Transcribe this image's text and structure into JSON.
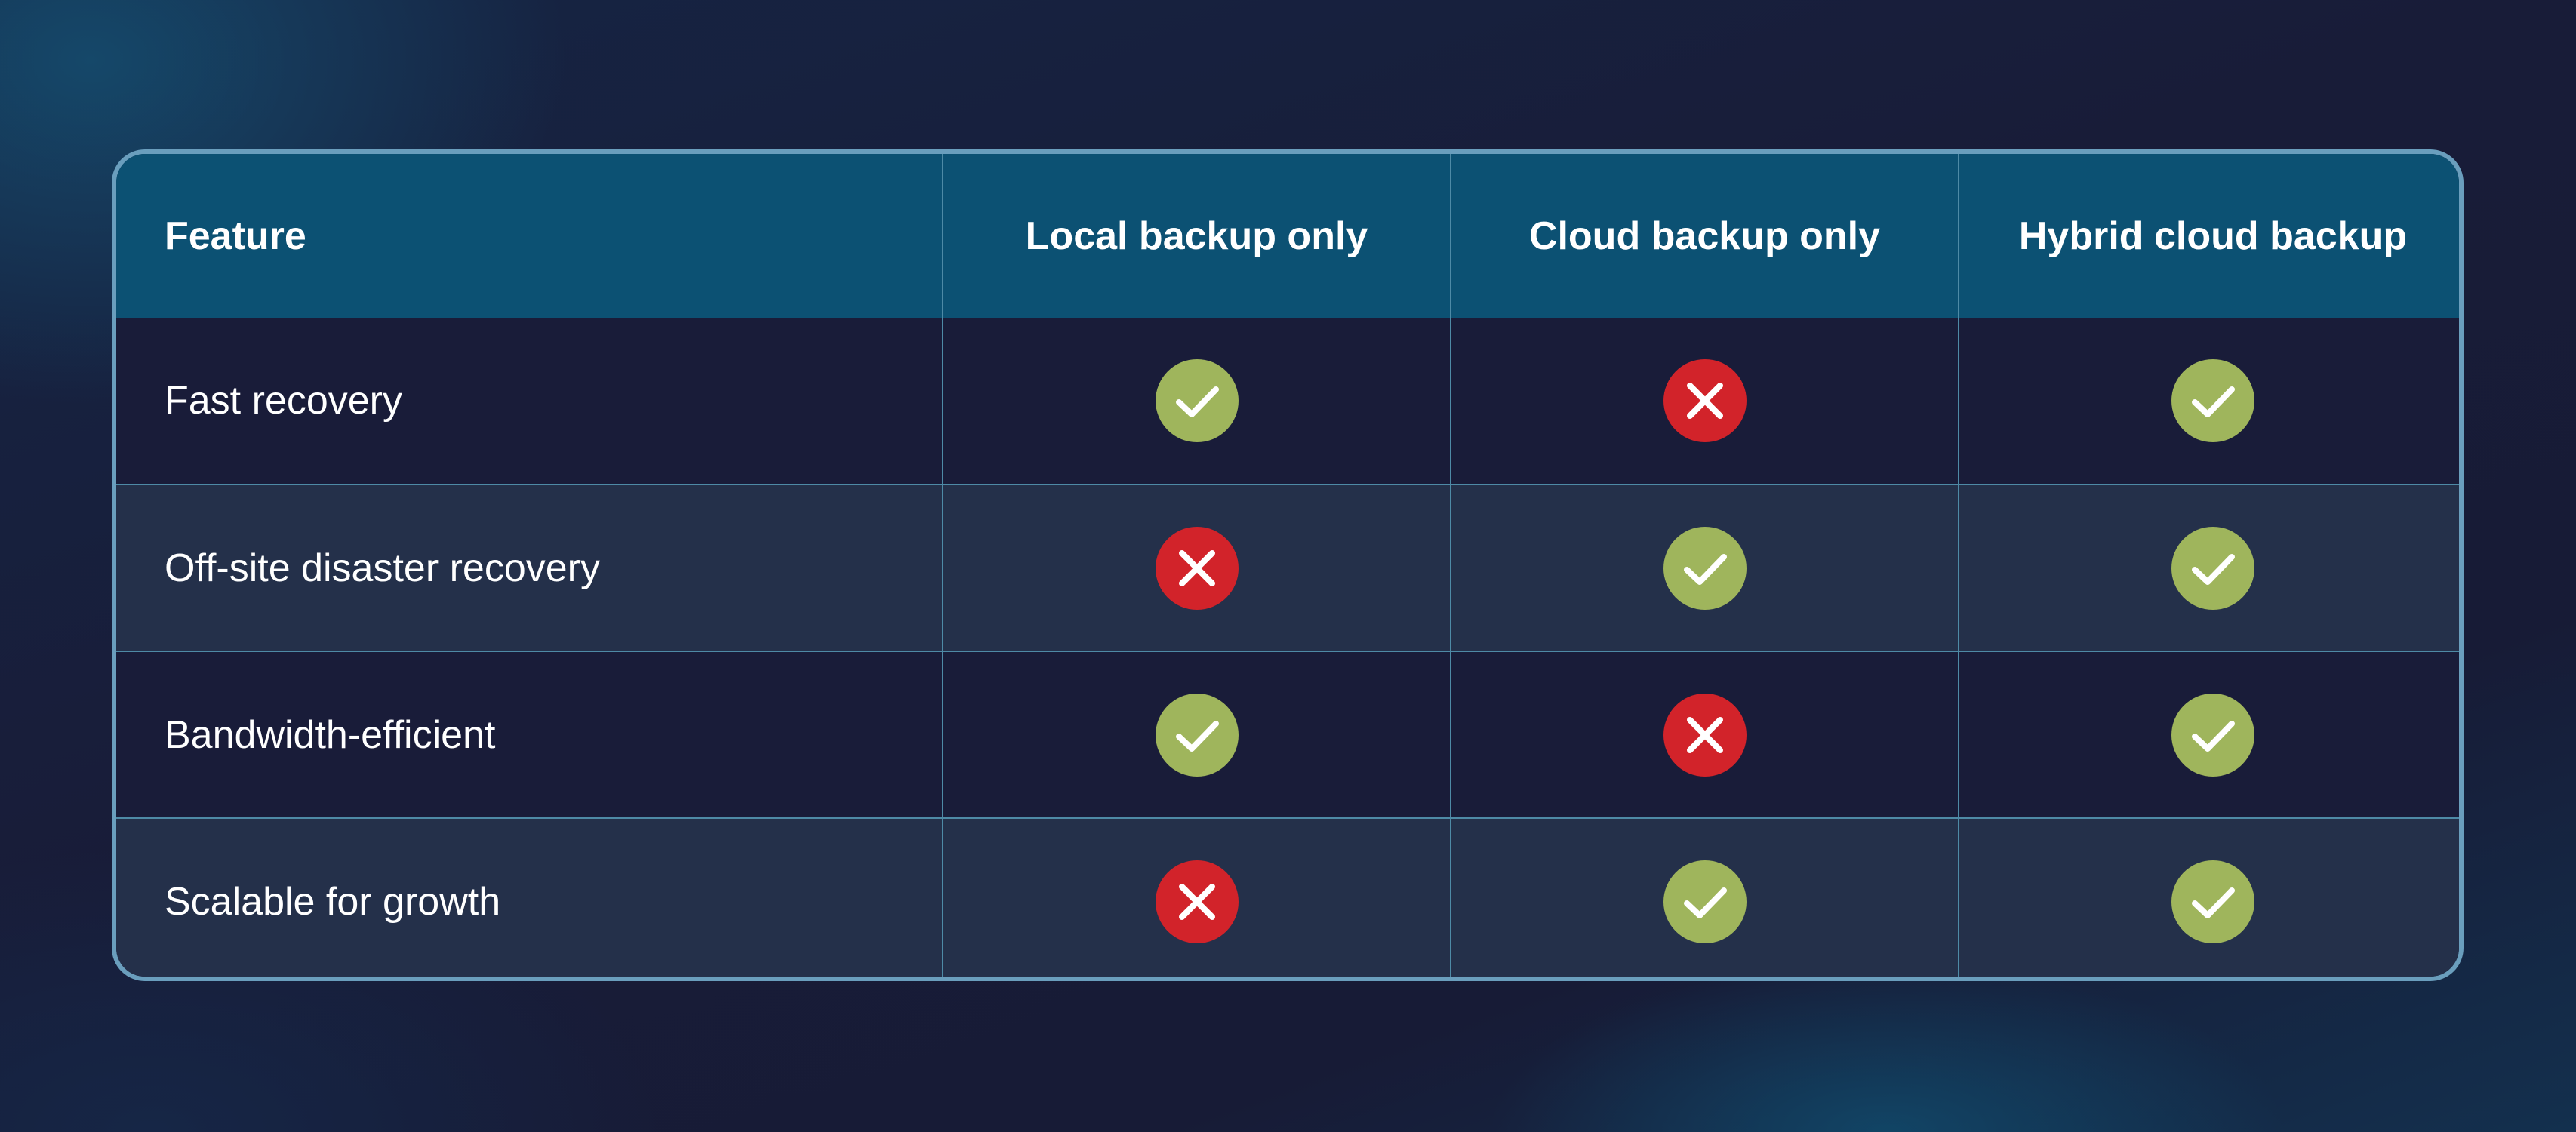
{
  "colors": {
    "yes": "#9fb55c",
    "no": "#d2232a",
    "header_bg": "#0c5173",
    "border": "#6a9ebd"
  },
  "table": {
    "headers": [
      "Feature",
      "Local backup only",
      "Cloud backup only",
      "Hybrid cloud backup"
    ],
    "rows": [
      {
        "feature": "Fast recovery",
        "values": [
          "yes",
          "no",
          "yes"
        ]
      },
      {
        "feature": "Off-site disaster recovery",
        "values": [
          "no",
          "yes",
          "yes"
        ]
      },
      {
        "feature": "Bandwidth-efficient",
        "values": [
          "yes",
          "no",
          "yes"
        ]
      },
      {
        "feature": "Scalable for growth",
        "values": [
          "no",
          "yes",
          "yes"
        ]
      }
    ]
  }
}
